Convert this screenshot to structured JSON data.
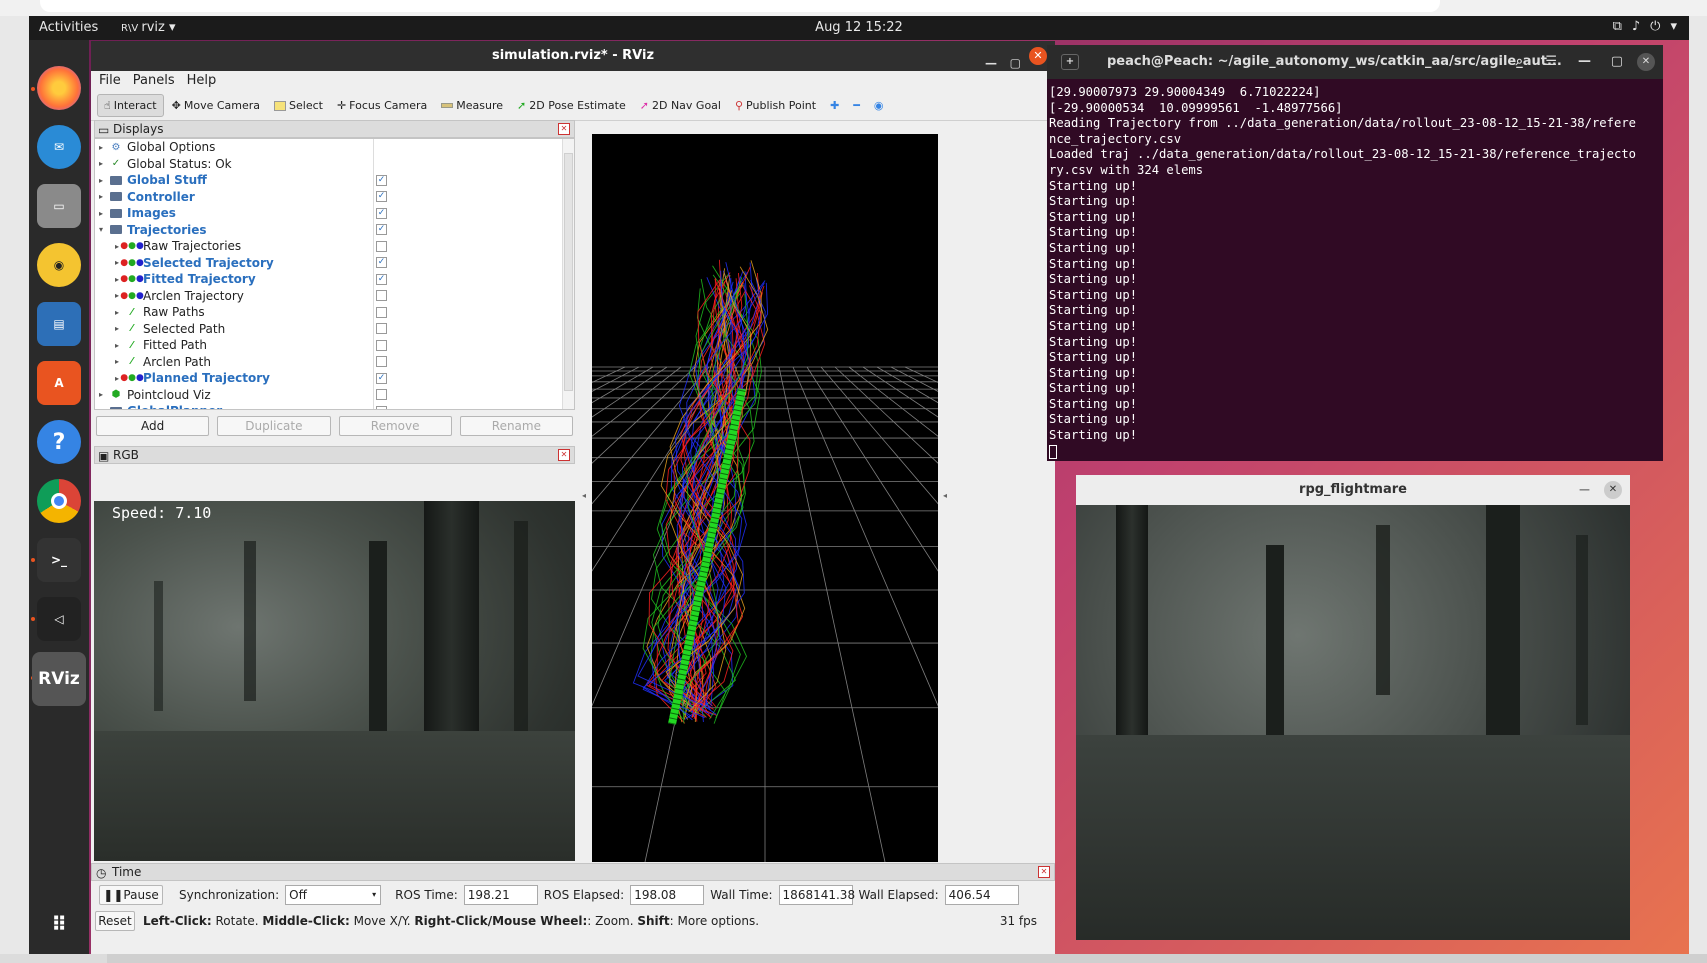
{
  "topbar": {
    "activities": "Activities",
    "app_name": "rviz",
    "clock": "Aug 12  15:22"
  },
  "rviz": {
    "title": "simulation.rviz* - RViz",
    "menu": [
      "File",
      "Panels",
      "Help"
    ],
    "toolbar": [
      "Interact",
      "Move Camera",
      "Select",
      "Focus Camera",
      "Measure",
      "2D Pose Estimate",
      "2D Nav Goal",
      "Publish Point"
    ],
    "displays_title": "Displays",
    "tree": [
      {
        "label": "Global Options",
        "icon": "gear-icon",
        "level": 0,
        "blue": false,
        "check": null
      },
      {
        "label": "Global Status: Ok",
        "icon": "check-icon",
        "level": 0,
        "blue": false,
        "check": null
      },
      {
        "label": "Global Stuff",
        "icon": "folder-icon",
        "level": 0,
        "blue": true,
        "check": true
      },
      {
        "label": "Controller",
        "icon": "folder-icon",
        "level": 0,
        "blue": true,
        "check": true
      },
      {
        "label": "Images",
        "icon": "folder-icon",
        "level": 0,
        "blue": true,
        "check": true
      },
      {
        "label": "Trajectories",
        "icon": "folder-icon",
        "level": 0,
        "blue": true,
        "check": true,
        "open": true
      },
      {
        "label": "Raw Trajectories",
        "icon": "marker-icon",
        "level": 1,
        "blue": false,
        "check": false
      },
      {
        "label": "Selected Trajectory",
        "icon": "marker-icon",
        "level": 1,
        "blue": true,
        "check": true
      },
      {
        "label": "Fitted Trajectory",
        "icon": "marker-icon",
        "level": 1,
        "blue": true,
        "check": true
      },
      {
        "label": "Arclen Trajectory",
        "icon": "marker-icon",
        "level": 1,
        "blue": false,
        "check": false
      },
      {
        "label": "Raw Paths",
        "icon": "path-icon",
        "level": 1,
        "blue": false,
        "check": false
      },
      {
        "label": "Selected Path",
        "icon": "path-icon",
        "level": 1,
        "blue": false,
        "check": false
      },
      {
        "label": "Fitted Path",
        "icon": "path-icon",
        "level": 1,
        "blue": false,
        "check": false
      },
      {
        "label": "Arclen Path",
        "icon": "path-icon",
        "level": 1,
        "blue": false,
        "check": false
      },
      {
        "label": "Planned Trajectory",
        "icon": "marker-icon",
        "level": 1,
        "blue": true,
        "check": true
      },
      {
        "label": "Pointcloud Viz",
        "icon": "cloud-icon",
        "level": 0,
        "blue": false,
        "check": false
      },
      {
        "label": "GlobalPlanner",
        "icon": "folder-icon",
        "level": 0,
        "blue": true,
        "check": false
      }
    ],
    "buttons": {
      "add": "Add",
      "duplicate": "Duplicate",
      "remove": "Remove",
      "rename": "Rename"
    },
    "rgb_title": "RGB",
    "speed": "Speed: 7.10",
    "time": {
      "title": "Time",
      "pause": "Pause",
      "sync_label": "Synchronization:",
      "sync_value": "Off",
      "ros_time_label": "ROS Time:",
      "ros_time": "198.21",
      "ros_elapsed_label": "ROS Elapsed:",
      "ros_elapsed": "198.08",
      "wall_time_label": "Wall Time:",
      "wall_time": "1868141.38",
      "wall_elapsed_label": "Wall Elapsed:",
      "wall_elapsed": "406.54"
    },
    "status": {
      "reset": "Reset",
      "left": "Left-Click:",
      "left_txt": " Rotate. ",
      "middle": "Middle-Click:",
      "middle_txt": " Move X/Y. ",
      "right": "Right-Click/Mouse Wheel:",
      "right_txt": ": Zoom. ",
      "shift": "Shift",
      "shift_txt": ": More options.",
      "fps": "31 fps"
    }
  },
  "terminal": {
    "title": "peach@Peach: ~/agile_autonomy_ws/catkin_aa/src/agile_aut...",
    "lines": [
      "[29.90007973 29.90004349  6.71022224]",
      "[-29.90000534  10.09999561  -1.48977566]",
      "Reading Trajectory from ../data_generation/data/rollout_23-08-12_15-21-38/refere",
      "nce_trajectory.csv",
      "Loaded traj ../data_generation/data/rollout_23-08-12_15-21-38/reference_trajecto",
      "ry.csv with 324 elems",
      "Starting up!",
      "Starting up!",
      "Starting up!",
      "Starting up!",
      "Starting up!",
      "Starting up!",
      "Starting up!",
      "Starting up!",
      "Starting up!",
      "Starting up!",
      "Starting up!",
      "Starting up!",
      "Starting up!",
      "Starting up!",
      "Starting up!",
      "Starting up!",
      "Starting up!"
    ]
  },
  "flightmare": {
    "title": "rpg_flightmare"
  }
}
